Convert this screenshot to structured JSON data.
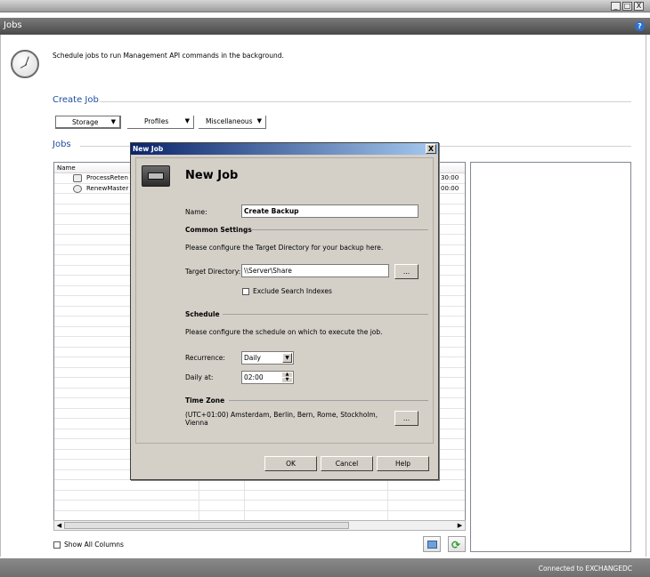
{
  "window": {
    "minimize": "_",
    "maximize": "□",
    "close": "X"
  },
  "header": {
    "title": "Jobs",
    "help": "?"
  },
  "intro": "Schedule jobs to run Management API commands in the background.",
  "create_job": {
    "title": "Create Job",
    "buttons": [
      "Storage",
      "Profiles",
      "Miscellaneous"
    ]
  },
  "jobs": {
    "title": "Jobs",
    "column_name": "Name",
    "rows": [
      {
        "name": "ProcessReten",
        "time": "30:00"
      },
      {
        "name": "RenewMaster",
        "time": "00:00"
      }
    ],
    "show_all_columns": "Show All Columns"
  },
  "status": "Connected to EXCHANGEDC",
  "dialog": {
    "window_title": "New Job",
    "close": "X",
    "heading": "New Job",
    "name_label": "Name:",
    "name_value": "Create Backup",
    "common_settings": "Common Settings",
    "common_desc": "Please configure the Target Directory for your backup here.",
    "target_label": "Target Directory:",
    "target_value": "\\\\Server\\Share",
    "browse": "...",
    "exclude_label": "Exclude Search Indexes",
    "schedule": "Schedule",
    "schedule_desc": "Please configure the schedule on which to execute the job.",
    "recurrence_label": "Recurrence:",
    "recurrence_value": "Daily",
    "daily_at_label": "Daily at:",
    "daily_at_value": "02:00",
    "time_zone": "Time Zone",
    "time_zone_value": "(UTC+01:00) Amsterdam, Berlin, Bern, Rome, Stockholm, Vienna",
    "tz_browse": "...",
    "ok": "OK",
    "cancel": "Cancel",
    "help": "Help"
  }
}
